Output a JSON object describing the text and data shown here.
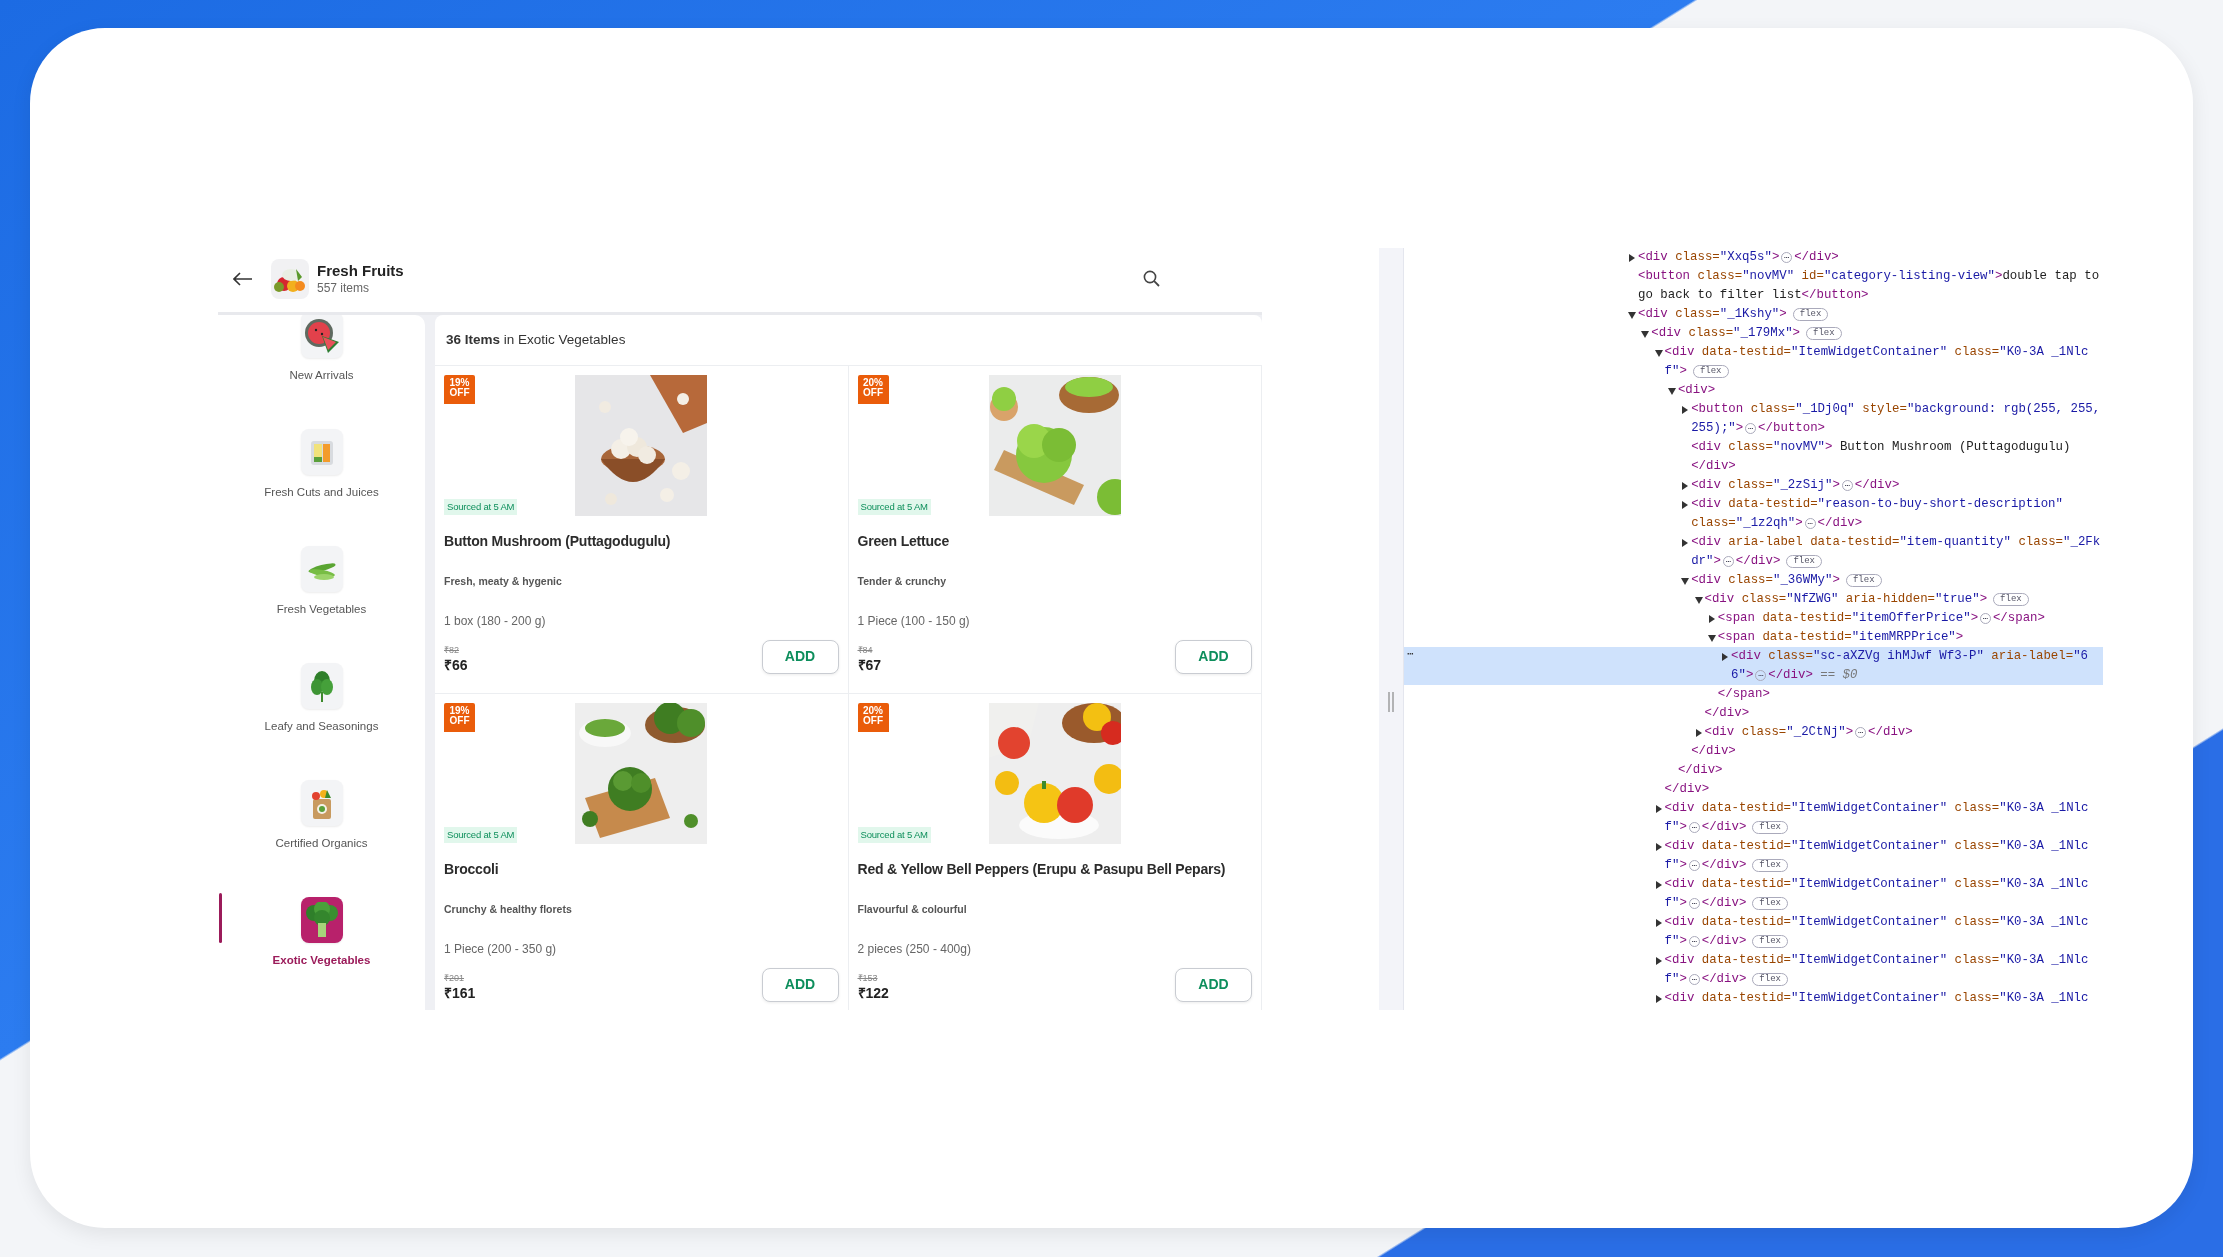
{
  "app": {
    "header": {
      "title": "Fresh Fruits",
      "subtitle": "557 items"
    },
    "sidebar": {
      "items": [
        {
          "label": "New Arrivals",
          "selected": false
        },
        {
          "label": "Fresh Cuts and Juices",
          "selected": false
        },
        {
          "label": "Fresh Vegetables",
          "selected": false
        },
        {
          "label": "Leafy and Seasonings",
          "selected": false
        },
        {
          "label": "Certified Organics",
          "selected": false
        },
        {
          "label": "Exotic Vegetables",
          "selected": true
        }
      ]
    },
    "listing": {
      "heading": "**36 Items** in Exotic Vegetables"
    },
    "products": [
      {
        "discount": "19% OFF",
        "sourced": "Sourced at 5 AM",
        "name": "Button Mushroom (Puttagodugulu)",
        "description": "Fresh, meaty & hygenic",
        "quantity": "1 box (180 - 200 g)",
        "mrp": "₹82",
        "price": "₹66",
        "button": "ADD"
      },
      {
        "discount": "20% OFF",
        "sourced": "Sourced at 5 AM",
        "name": "Green Lettuce",
        "description": "Tender & crunchy",
        "quantity": "1 Piece (100 - 150 g)",
        "mrp": "₹84",
        "price": "₹67",
        "button": "ADD"
      },
      {
        "discount": "19% OFF",
        "sourced": "Sourced at 5 AM",
        "name": "Broccoli",
        "description": "Crunchy & healthy florets",
        "quantity": "1 Piece (200 - 350 g)",
        "mrp": "₹201",
        "price": "₹161",
        "button": "ADD"
      },
      {
        "discount": "20% OFF",
        "sourced": "Sourced at 5 AM",
        "name": "Red & Yellow Bell Peppers (Erupu & Pasupu Bell Pepars)",
        "description": "Flavourful & colourful",
        "quantity": "2 pieces (250 - 400g)",
        "mrp": "₹153",
        "price": "₹122",
        "button": "ADD"
      }
    ]
  },
  "devtools": {
    "nodes": [
      {
        "expandable": true,
        "expanded": false,
        "selected": false,
        "lines": [
          [
            {
              "kind": "tag",
              "text": "<div"
            },
            {
              "kind": "attr",
              "text": " class="
            },
            {
              "kind": "val",
              "text": "\"Xxq5s\""
            },
            {
              "kind": "tag",
              "text": ">"
            },
            {
              "kind": "dots",
              "text": "⋯"
            },
            {
              "kind": "tag",
              "text": "</div>"
            }
          ]
        ]
      },
      {
        "expandable": false,
        "selected": false,
        "lines": [
          [
            {
              "kind": "tag",
              "text": "<button"
            },
            {
              "kind": "attr",
              "text": " class="
            },
            {
              "kind": "val",
              "text": "\"novMV\""
            },
            {
              "kind": "attr",
              "text": " id="
            },
            {
              "kind": "val",
              "text": "\"category-listing-view\""
            },
            {
              "kind": "tag",
              "text": ">"
            },
            {
              "kind": "txt",
              "text": "double tap to"
            }
          ],
          [
            {
              "kind": "txt",
              "text": "go back to filter list"
            },
            {
              "kind": "tag",
              "text": "</button>"
            }
          ]
        ]
      },
      {
        "expandable": true,
        "expanded": true,
        "selected": false,
        "lines": [
          [
            {
              "kind": "tag",
              "text": "<div"
            },
            {
              "kind": "attr",
              "text": " class="
            },
            {
              "kind": "val",
              "text": "\"_1Kshy\""
            },
            {
              "kind": "tag",
              "text": ">"
            },
            {
              "kind": "flex",
              "text": "flex"
            }
          ]
        ],
        "children": [
          {
            "expandable": true,
            "expanded": true,
            "selected": false,
            "lines": [
              [
                {
                  "kind": "tag",
                  "text": "<div"
                },
                {
                  "kind": "attr",
                  "text": " class="
                },
                {
                  "kind": "val",
                  "text": "\"_179Mx\""
                },
                {
                  "kind": "tag",
                  "text": ">"
                },
                {
                  "kind": "flex",
                  "text": "flex"
                }
              ]
            ],
            "children": [
              {
                "expandable": true,
                "expanded": true,
                "selected": false,
                "lines": [
                  [
                    {
                      "kind": "tag",
                      "text": "<div"
                    },
                    {
                      "kind": "attr",
                      "text": " data-testid="
                    },
                    {
                      "kind": "val",
                      "text": "\"ItemWidgetContainer\""
                    },
                    {
                      "kind": "attr",
                      "text": " class="
                    },
                    {
                      "kind": "val",
                      "text": "\"K0-3A _1Nlc"
                    }
                  ],
                  [
                    {
                      "kind": "val",
                      "text": "f\""
                    },
                    {
                      "kind": "tag",
                      "text": ">"
                    },
                    {
                      "kind": "flex",
                      "text": "flex"
                    }
                  ]
                ],
                "children": [
                  {
                    "expandable": true,
                    "expanded": true,
                    "selected": false,
                    "lines": [
                      [
                        {
                          "kind": "tag",
                          "text": "<div>"
                        }
                      ]
                    ],
                    "children": [
                      {
                        "expandable": true,
                        "expanded": false,
                        "selected": false,
                        "lines": [
                          [
                            {
                              "kind": "tag",
                              "text": "<button"
                            },
                            {
                              "kind": "attr",
                              "text": " class="
                            },
                            {
                              "kind": "val",
                              "text": "\"_1Dj0q\""
                            },
                            {
                              "kind": "attr",
                              "text": " style="
                            },
                            {
                              "kind": "val",
                              "text": "\"background: rgb(255, 255,"
                            }
                          ],
                          [
                            {
                              "kind": "val",
                              "text": "255);\""
                            },
                            {
                              "kind": "tag",
                              "text": ">"
                            },
                            {
                              "kind": "dots",
                              "text": "⋯"
                            },
                            {
                              "kind": "tag",
                              "text": "</button>"
                            }
                          ]
                        ]
                      },
                      {
                        "expandable": false,
                        "selected": false,
                        "lines": [
                          [
                            {
                              "kind": "tag",
                              "text": "<div"
                            },
                            {
                              "kind": "attr",
                              "text": " class="
                            },
                            {
                              "kind": "val",
                              "text": "\"novMV\""
                            },
                            {
                              "kind": "tag",
                              "text": ">"
                            },
                            {
                              "kind": "txt",
                              "text": " Button Mushroom (Puttagodugulu)"
                            }
                          ],
                          [
                            {
                              "kind": "tag",
                              "text": "</div>"
                            }
                          ]
                        ]
                      },
                      {
                        "expandable": true,
                        "expanded": false,
                        "selected": false,
                        "lines": [
                          [
                            {
                              "kind": "tag",
                              "text": "<div"
                            },
                            {
                              "kind": "attr",
                              "text": " class="
                            },
                            {
                              "kind": "val",
                              "text": "\"_2zSij\""
                            },
                            {
                              "kind": "tag",
                              "text": ">"
                            },
                            {
                              "kind": "dots",
                              "text": "⋯"
                            },
                            {
                              "kind": "tag",
                              "text": "</div>"
                            }
                          ]
                        ]
                      },
                      {
                        "expandable": true,
                        "expanded": false,
                        "selected": false,
                        "lines": [
                          [
                            {
                              "kind": "tag",
                              "text": "<div"
                            },
                            {
                              "kind": "attr",
                              "text": " data-testid="
                            },
                            {
                              "kind": "val",
                              "text": "\"reason-to-buy-short-description\""
                            }
                          ],
                          [
                            {
                              "kind": "attr",
                              "text": "class="
                            },
                            {
                              "kind": "val",
                              "text": "\"_1z2qh\""
                            },
                            {
                              "kind": "tag",
                              "text": ">"
                            },
                            {
                              "kind": "dots",
                              "text": "⋯"
                            },
                            {
                              "kind": "tag",
                              "text": "</div>"
                            }
                          ]
                        ]
                      },
                      {
                        "expandable": true,
                        "expanded": false,
                        "selected": false,
                        "lines": [
                          [
                            {
                              "kind": "tag",
                              "text": "<div"
                            },
                            {
                              "kind": "attr",
                              "text": " aria-label data-testid="
                            },
                            {
                              "kind": "val",
                              "text": "\"item-quantity\""
                            },
                            {
                              "kind": "attr",
                              "text": " class="
                            },
                            {
                              "kind": "val",
                              "text": "\"_2Fk"
                            }
                          ],
                          [
                            {
                              "kind": "val",
                              "text": "dr\""
                            },
                            {
                              "kind": "tag",
                              "text": ">"
                            },
                            {
                              "kind": "dots",
                              "text": "⋯"
                            },
                            {
                              "kind": "tag",
                              "text": "</div>"
                            },
                            {
                              "kind": "flex",
                              "text": "flex"
                            }
                          ]
                        ]
                      },
                      {
                        "expandable": true,
                        "expanded": true,
                        "selected": false,
                        "lines": [
                          [
                            {
                              "kind": "tag",
                              "text": "<div"
                            },
                            {
                              "kind": "attr",
                              "text": " class="
                            },
                            {
                              "kind": "val",
                              "text": "\"_36WMy\""
                            },
                            {
                              "kind": "tag",
                              "text": ">"
                            },
                            {
                              "kind": "flex",
                              "text": "flex"
                            }
                          ]
                        ],
                        "children": [
                          {
                            "expandable": true,
                            "expanded": true,
                            "selected": false,
                            "lines": [
                              [
                                {
                                  "kind": "tag",
                                  "text": "<div"
                                },
                                {
                                  "kind": "attr",
                                  "text": " class="
                                },
                                {
                                  "kind": "val",
                                  "text": "\"NfZWG\""
                                },
                                {
                                  "kind": "attr",
                                  "text": " aria-hidden="
                                },
                                {
                                  "kind": "val",
                                  "text": "\"true\""
                                },
                                {
                                  "kind": "tag",
                                  "text": ">"
                                },
                                {
                                  "kind": "flex",
                                  "text": "flex"
                                }
                              ]
                            ],
                            "children": [
                              {
                                "expandable": true,
                                "expanded": false,
                                "selected": false,
                                "lines": [
                                  [
                                    {
                                      "kind": "tag",
                                      "text": "<span"
                                    },
                                    {
                                      "kind": "attr",
                                      "text": " data-testid="
                                    },
                                    {
                                      "kind": "val",
                                      "text": "\"itemOfferPrice\""
                                    },
                                    {
                                      "kind": "tag",
                                      "text": ">"
                                    },
                                    {
                                      "kind": "dots",
                                      "text": "⋯"
                                    },
                                    {
                                      "kind": "tag",
                                      "text": "</span>"
                                    }
                                  ]
                                ]
                              },
                              {
                                "expandable": true,
                                "expanded": true,
                                "selected": false,
                                "lines": [
                                  [
                                    {
                                      "kind": "tag",
                                      "text": "<span"
                                    },
                                    {
                                      "kind": "attr",
                                      "text": " data-testid="
                                    },
                                    {
                                      "kind": "val",
                                      "text": "\"itemMRPPrice\""
                                    },
                                    {
                                      "kind": "tag",
                                      "text": ">"
                                    }
                                  ]
                                ],
                                "children": [
                                  {
                                    "expandable": true,
                                    "expanded": false,
                                    "selected": true,
                                    "gutter": "⋯",
                                    "lines": [
                                      [
                                        {
                                          "kind": "tag",
                                          "text": "<div"
                                        },
                                        {
                                          "kind": "attr",
                                          "text": " class="
                                        },
                                        {
                                          "kind": "val",
                                          "text": "\"sc-aXZVg ihMJwf Wf3-P\""
                                        },
                                        {
                                          "kind": "attr",
                                          "text": " aria-label="
                                        },
                                        {
                                          "kind": "val",
                                          "text": "\"6"
                                        }
                                      ],
                                      [
                                        {
                                          "kind": "val",
                                          "text": "6\""
                                        },
                                        {
                                          "kind": "tag",
                                          "text": ">"
                                        },
                                        {
                                          "kind": "dots",
                                          "text": "⋯"
                                        },
                                        {
                                          "kind": "tag",
                                          "text": "</div>"
                                        },
                                        {
                                          "kind": "ref",
                                          "text": " == $0"
                                        }
                                      ]
                                    ]
                                  }
                                ],
                                "close": [
                                  {
                                    "kind": "tag",
                                    "text": "</span>"
                                  }
                                ]
                              }
                            ],
                            "close": [
                              {
                                "kind": "tag",
                                "text": "</div>"
                              }
                            ]
                          },
                          {
                            "expandable": true,
                            "expanded": false,
                            "selected": false,
                            "lines": [
                              [
                                {
                                  "kind": "tag",
                                  "text": "<div"
                                },
                                {
                                  "kind": "attr",
                                  "text": " class="
                                },
                                {
                                  "kind": "val",
                                  "text": "\"_2CtNj\""
                                },
                                {
                                  "kind": "tag",
                                  "text": ">"
                                },
                                {
                                  "kind": "dots",
                                  "text": "⋯"
                                },
                                {
                                  "kind": "tag",
                                  "text": "</div>"
                                }
                              ]
                            ]
                          }
                        ],
                        "close": [
                          {
                            "kind": "tag",
                            "text": "</div>"
                          }
                        ]
                      }
                    ],
                    "close": [
                      {
                        "kind": "tag",
                        "text": "</div>"
                      }
                    ]
                  }
                ],
                "close": [
                  {
                    "kind": "tag",
                    "text": "</div>"
                  }
                ]
              },
              {
                "expandable": true,
                "expanded": false,
                "selected": false,
                "lines": [
                  [
                    {
                      "kind": "tag",
                      "text": "<div"
                    },
                    {
                      "kind": "attr",
                      "text": " data-testid="
                    },
                    {
                      "kind": "val",
                      "text": "\"ItemWidgetContainer\""
                    },
                    {
                      "kind": "attr",
                      "text": " class="
                    },
                    {
                      "kind": "val",
                      "text": "\"K0-3A _1Nlc"
                    }
                  ],
                  [
                    {
                      "kind": "val",
                      "text": "f\""
                    },
                    {
                      "kind": "tag",
                      "text": ">"
                    },
                    {
                      "kind": "dots",
                      "text": "⋯"
                    },
                    {
                      "kind": "tag",
                      "text": "</div>"
                    },
                    {
                      "kind": "flex",
                      "text": "flex"
                    }
                  ]
                ]
              },
              {
                "expandable": true,
                "expanded": false,
                "selected": false,
                "lines": [
                  [
                    {
                      "kind": "tag",
                      "text": "<div"
                    },
                    {
                      "kind": "attr",
                      "text": " data-testid="
                    },
                    {
                      "kind": "val",
                      "text": "\"ItemWidgetContainer\""
                    },
                    {
                      "kind": "attr",
                      "text": " class="
                    },
                    {
                      "kind": "val",
                      "text": "\"K0-3A _1Nlc"
                    }
                  ],
                  [
                    {
                      "kind": "val",
                      "text": "f\""
                    },
                    {
                      "kind": "tag",
                      "text": ">"
                    },
                    {
                      "kind": "dots",
                      "text": "⋯"
                    },
                    {
                      "kind": "tag",
                      "text": "</div>"
                    },
                    {
                      "kind": "flex",
                      "text": "flex"
                    }
                  ]
                ]
              },
              {
                "expandable": true,
                "expanded": false,
                "selected": false,
                "lines": [
                  [
                    {
                      "kind": "tag",
                      "text": "<div"
                    },
                    {
                      "kind": "attr",
                      "text": " data-testid="
                    },
                    {
                      "kind": "val",
                      "text": "\"ItemWidgetContainer\""
                    },
                    {
                      "kind": "attr",
                      "text": " class="
                    },
                    {
                      "kind": "val",
                      "text": "\"K0-3A _1Nlc"
                    }
                  ],
                  [
                    {
                      "kind": "val",
                      "text": "f\""
                    },
                    {
                      "kind": "tag",
                      "text": ">"
                    },
                    {
                      "kind": "dots",
                      "text": "⋯"
                    },
                    {
                      "kind": "tag",
                      "text": "</div>"
                    },
                    {
                      "kind": "flex",
                      "text": "flex"
                    }
                  ]
                ]
              },
              {
                "expandable": true,
                "expanded": false,
                "selected": false,
                "lines": [
                  [
                    {
                      "kind": "tag",
                      "text": "<div"
                    },
                    {
                      "kind": "attr",
                      "text": " data-testid="
                    },
                    {
                      "kind": "val",
                      "text": "\"ItemWidgetContainer\""
                    },
                    {
                      "kind": "attr",
                      "text": " class="
                    },
                    {
                      "kind": "val",
                      "text": "\"K0-3A _1Nlc"
                    }
                  ],
                  [
                    {
                      "kind": "val",
                      "text": "f\""
                    },
                    {
                      "kind": "tag",
                      "text": ">"
                    },
                    {
                      "kind": "dots",
                      "text": "⋯"
                    },
                    {
                      "kind": "tag",
                      "text": "</div>"
                    },
                    {
                      "kind": "flex",
                      "text": "flex"
                    }
                  ]
                ]
              },
              {
                "expandable": true,
                "expanded": false,
                "selected": false,
                "lines": [
                  [
                    {
                      "kind": "tag",
                      "text": "<div"
                    },
                    {
                      "kind": "attr",
                      "text": " data-testid="
                    },
                    {
                      "kind": "val",
                      "text": "\"ItemWidgetContainer\""
                    },
                    {
                      "kind": "attr",
                      "text": " class="
                    },
                    {
                      "kind": "val",
                      "text": "\"K0-3A _1Nlc"
                    }
                  ],
                  [
                    {
                      "kind": "val",
                      "text": "f\""
                    },
                    {
                      "kind": "tag",
                      "text": ">"
                    },
                    {
                      "kind": "dots",
                      "text": "⋯"
                    },
                    {
                      "kind": "tag",
                      "text": "</div>"
                    },
                    {
                      "kind": "flex",
                      "text": "flex"
                    }
                  ]
                ]
              },
              {
                "expandable": true,
                "expanded": false,
                "selected": false,
                "lines": [
                  [
                    {
                      "kind": "tag",
                      "text": "<div"
                    },
                    {
                      "kind": "attr",
                      "text": " data-testid="
                    },
                    {
                      "kind": "val",
                      "text": "\"ItemWidgetContainer\""
                    },
                    {
                      "kind": "attr",
                      "text": " class="
                    },
                    {
                      "kind": "val",
                      "text": "\"K0-3A _1Nlc"
                    }
                  ]
                ]
              }
            ]
          }
        ]
      }
    ]
  }
}
